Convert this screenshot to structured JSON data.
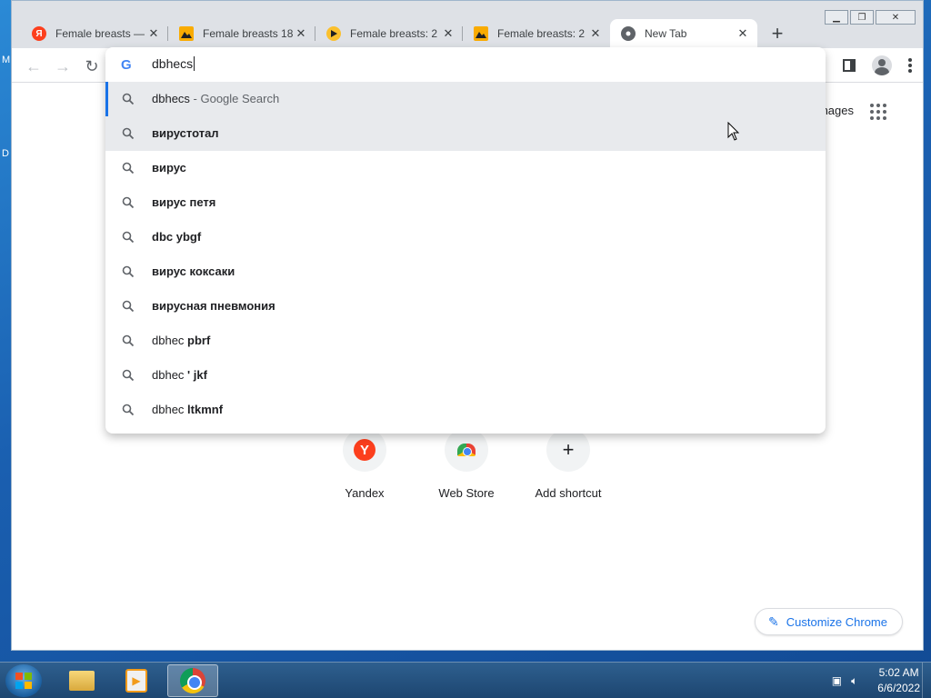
{
  "desktop": {
    "edge_letters": [
      "M",
      "D"
    ]
  },
  "browser": {
    "tabs": [
      {
        "title": "Female breasts —",
        "favicon": "yandex-icon",
        "fav_color": "#fc3f1d",
        "fav_text": "Я"
      },
      {
        "title": "Female breasts 18",
        "favicon": "image-icon",
        "fav_color": "#f9ab00",
        "fav_text": ""
      },
      {
        "title": "Female breasts: 2",
        "favicon": "play-icon",
        "fav_color": "#fbc02d",
        "fav_text": ""
      },
      {
        "title": "Female breasts: 2",
        "favicon": "image-icon",
        "fav_color": "#f9ab00",
        "fav_text": ""
      },
      {
        "title": "New Tab",
        "favicon": "chrome-icon",
        "fav_color": "#5f6368",
        "fav_text": "",
        "active": true
      }
    ],
    "omnibox": {
      "value": "dbhecs",
      "suggestions": [
        {
          "plain": "dbhecs",
          "bold": "",
          "sub": " - Google Search"
        },
        {
          "plain": "",
          "bold": "вирустотал",
          "sub": ""
        },
        {
          "plain": "",
          "bold": "вирус",
          "sub": ""
        },
        {
          "plain": "",
          "bold": "вирус петя",
          "sub": ""
        },
        {
          "plain": "",
          "bold": "dbc ybgf",
          "sub": ""
        },
        {
          "plain": "",
          "bold": "вирус коксаки",
          "sub": ""
        },
        {
          "plain": "",
          "bold": "вирусная пневмония",
          "sub": ""
        },
        {
          "plain": "dbhec ",
          "bold": "pbrf",
          "sub": ""
        },
        {
          "plain": "dbhec ",
          "bold": "' jkf",
          "sub": ""
        },
        {
          "plain": "dbhec ",
          "bold": "ltkmnf",
          "sub": ""
        }
      ]
    },
    "ntp": {
      "images_link": "nages",
      "shortcuts": [
        {
          "label": "Yandex"
        },
        {
          "label": "Web Store"
        },
        {
          "label": "Add shortcut"
        }
      ],
      "customize_label": "Customize Chrome"
    }
  },
  "taskbar": {
    "time": "5:02 AM",
    "date": "6/6/2022"
  },
  "colors": {
    "accent": "#1a73e8",
    "selected_row": "#e8eaed"
  }
}
